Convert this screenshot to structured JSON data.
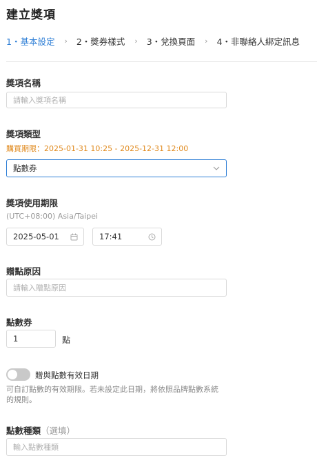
{
  "page": {
    "title": "建立獎項"
  },
  "steps": [
    {
      "label": "1・基本設定",
      "active": true
    },
    {
      "label": "2・獎券樣式",
      "active": false
    },
    {
      "label": "3・兌換頁面",
      "active": false
    },
    {
      "label": "4・非聯絡人綁定訊息",
      "active": false
    }
  ],
  "prize_name": {
    "label": "獎項名稱",
    "placeholder": "請輸入獎項名稱"
  },
  "prize_type": {
    "label": "獎項類型",
    "purchase_period": "購買期限：2025-01-31 10:25 - 2025-12-31 12:00",
    "selected": "點數券"
  },
  "usage_period": {
    "label": "獎項使用期限",
    "timezone": "(UTC+08:00) Asia/Taipei",
    "date": "2025-05-01",
    "time": "17:41"
  },
  "reason": {
    "label": "贈點原因",
    "placeholder": "請輸入贈點原因"
  },
  "points": {
    "label": "點數券",
    "value": "1",
    "unit": "點"
  },
  "expiry_toggle": {
    "label": "贈與點數有效日期",
    "enabled": false,
    "hint_line1": "可自訂點數的有效期限。若未設定此日期，將依照品牌點數系統",
    "hint_line2": "的規則。"
  },
  "point_type": {
    "label": "點數種類",
    "optional": "（選填）",
    "placeholder": "輸入點數種類"
  },
  "colors": {
    "accent": "#2f7fd6",
    "warning": "#e08a1e"
  }
}
